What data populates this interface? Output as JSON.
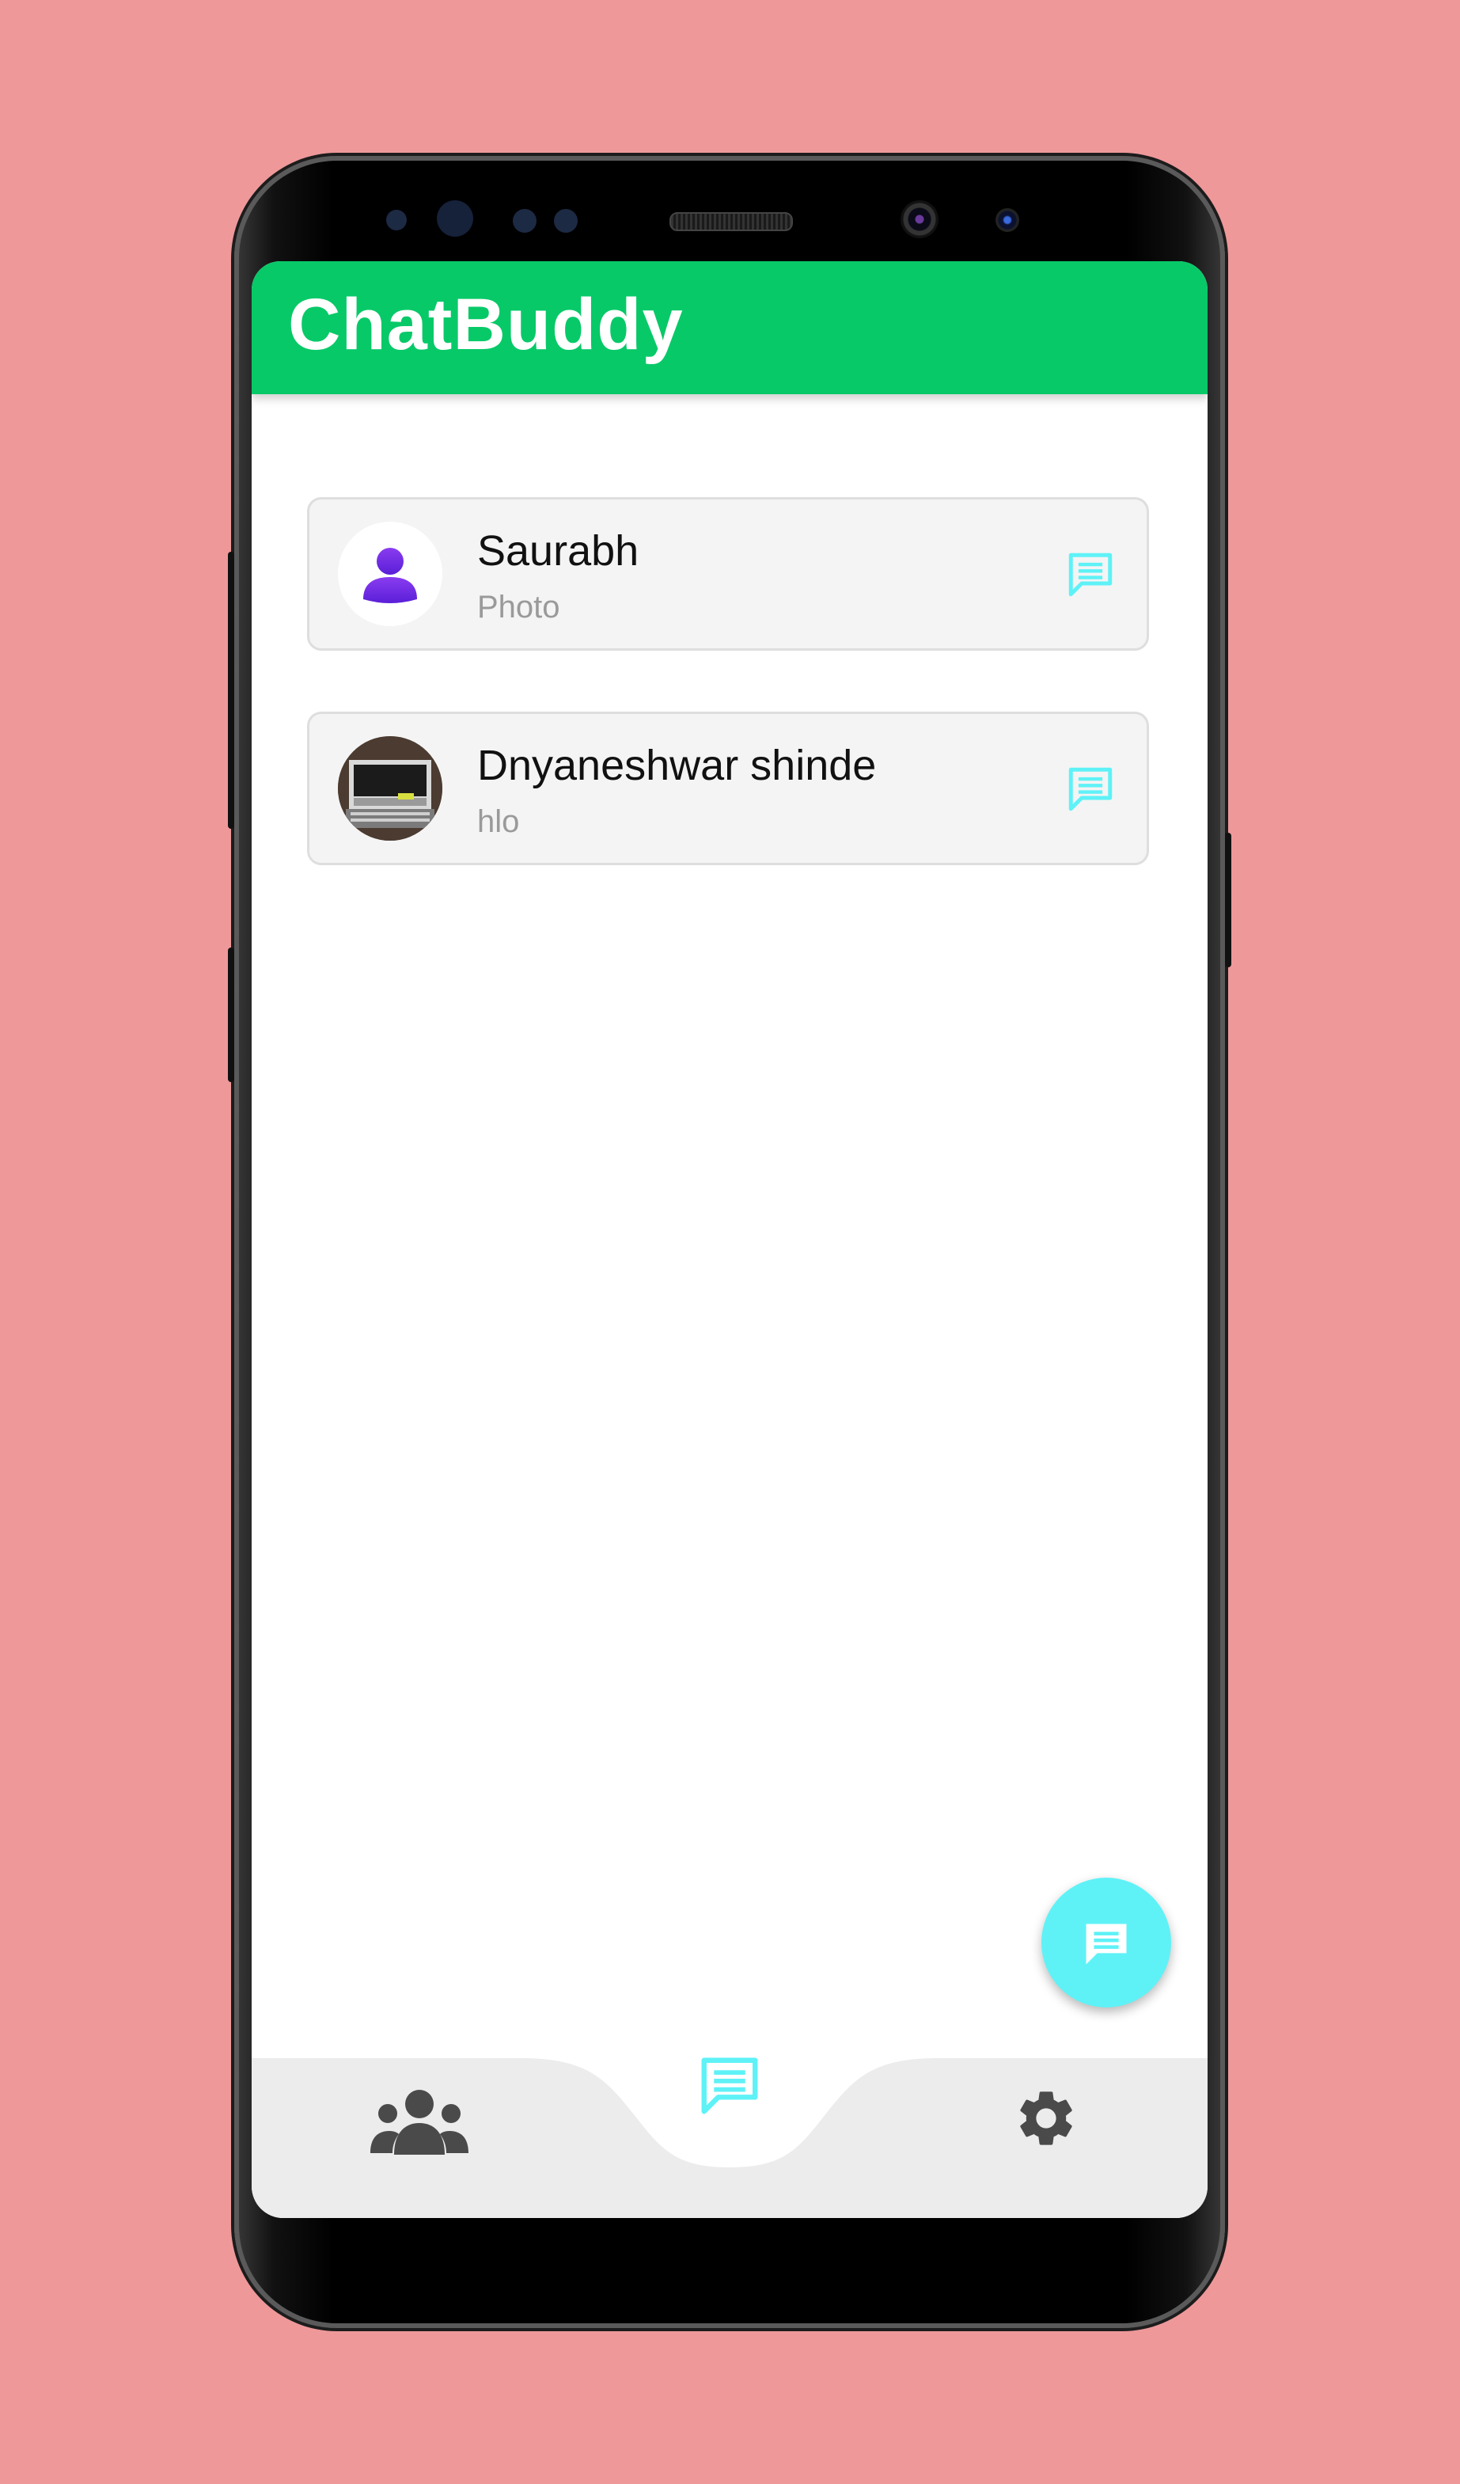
{
  "app": {
    "title": "ChatBuddy"
  },
  "chats": [
    {
      "name": "Saurabh",
      "preview": "Photo",
      "avatar": "default-user-avatar"
    },
    {
      "name": "Dnyaneshwar shinde",
      "preview": "hlo",
      "avatar": "photo-avatar"
    }
  ],
  "bottom_nav": {
    "items": [
      {
        "icon": "people-icon",
        "active": false
      },
      {
        "icon": "chat-icon",
        "active": true
      },
      {
        "icon": "gear-icon",
        "active": false
      }
    ]
  },
  "fab": {
    "icon": "new-chat-icon"
  },
  "colors": {
    "background": "#ee989a",
    "appbar": "#08c968",
    "accent": "#5ef2f7",
    "avatar_purple": "#7a2ee6",
    "nav_icon": "#4a4a4a",
    "nav_bg": "#ececec"
  }
}
